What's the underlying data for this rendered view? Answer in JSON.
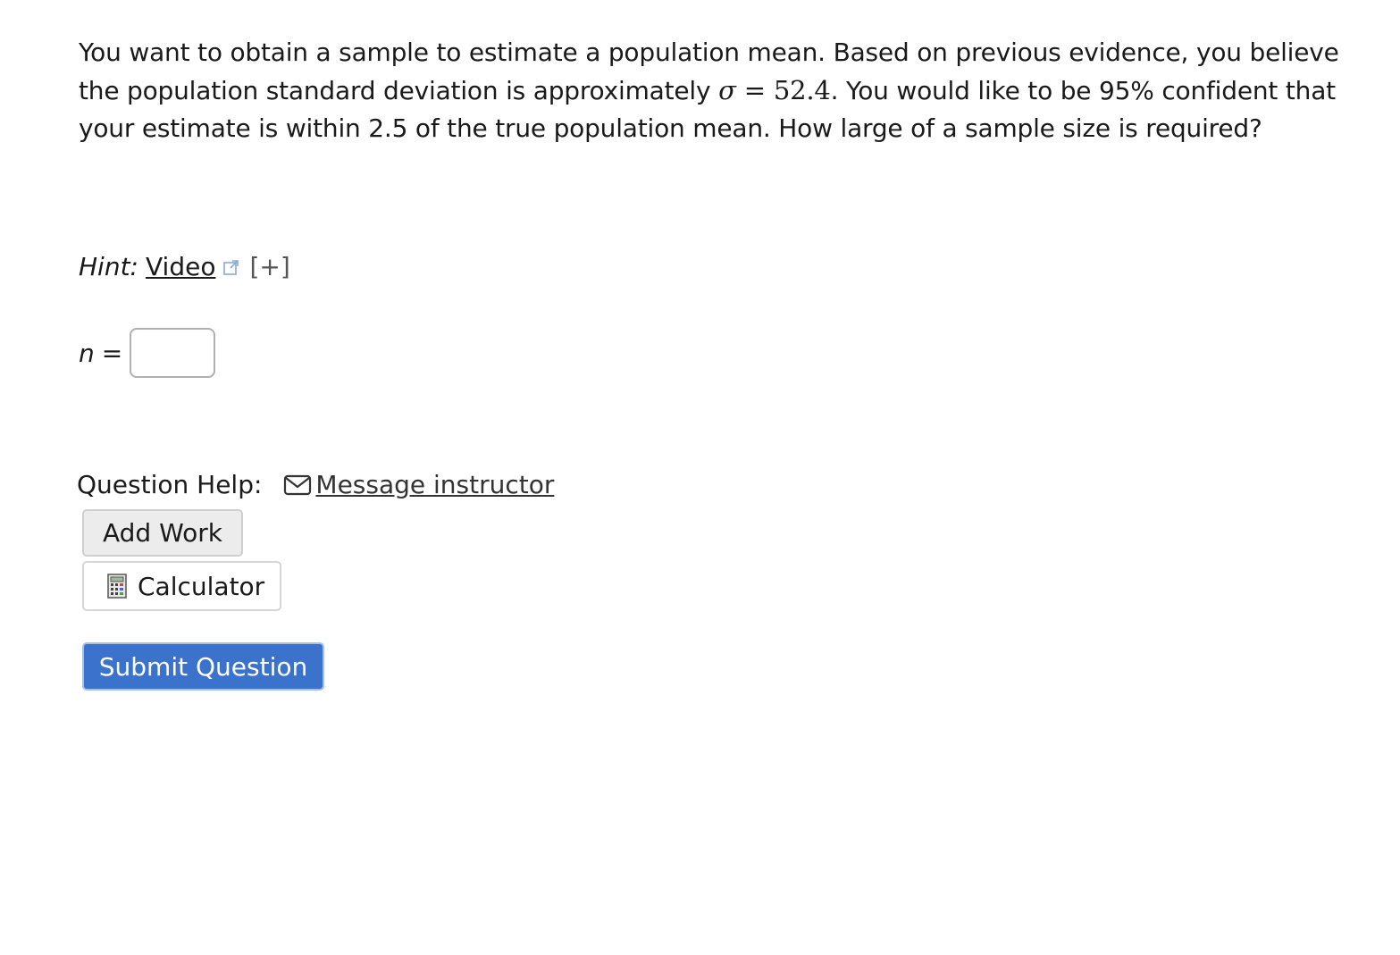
{
  "question": {
    "text_part1": "You want to obtain a sample to estimate a population mean. Based on previous evidence, you believe the population standard deviation is approximately ",
    "sigma_symbol": "σ",
    "equals": " = ",
    "sigma_value": "52.4",
    "text_part2": ". You would like to be 95% confident that your estimate is within 2.5 of the true population mean. How large of a sample size is required?"
  },
  "hint": {
    "label": "Hint:",
    "link_text": "Video",
    "expand_text": "[+]"
  },
  "answer": {
    "variable": "n",
    "equals": "=",
    "value": "",
    "placeholder": ""
  },
  "help": {
    "label": "Question Help:",
    "message_link": "Message instructor"
  },
  "buttons": {
    "add_work": "Add Work",
    "calculator": "Calculator",
    "submit": "Submit Question"
  },
  "icons": {
    "external_link": "external-link-icon",
    "mail": "mail-icon",
    "calculator": "calculator-icon"
  },
  "colors": {
    "submit_bg": "#3b73cc",
    "submit_text": "#ffffff"
  }
}
